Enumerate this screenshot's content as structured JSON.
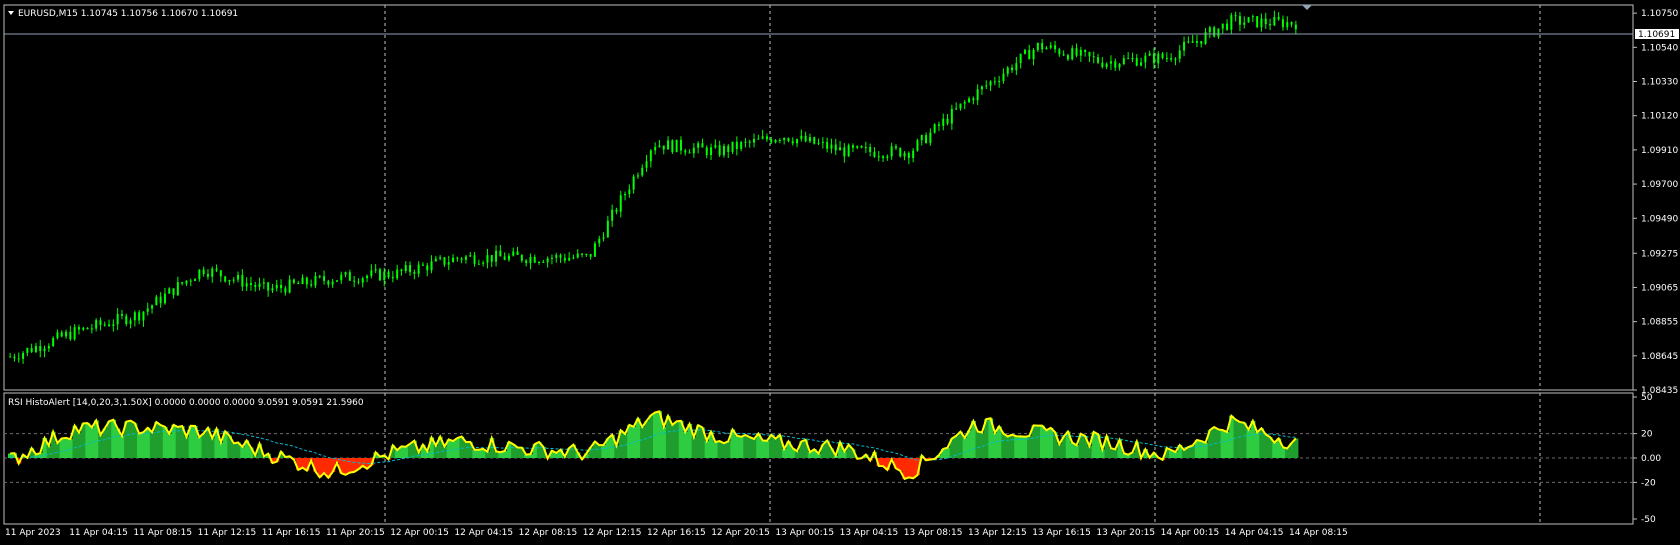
{
  "main_panel": {
    "title": "EURUSD,M15  1.10745 1.10756 1.10670 1.10691",
    "current_price": "1.10691",
    "price_ticks": [
      "1.10750",
      "1.10540",
      "1.10330",
      "1.10120",
      "1.09910",
      "1.09700",
      "1.09490",
      "1.09275",
      "1.09065",
      "1.08855",
      "1.08645",
      "1.08435"
    ]
  },
  "indicator_panel": {
    "title": "RSI HistoAlert [14,0,20,3,1.50X] 0.0000 0.0000 0.0000 9.0591 9.0591 21.5960",
    "ticks": [
      "50",
      "20",
      "0.00",
      "-20",
      "-50"
    ]
  },
  "time_axis": {
    "labels": [
      "11 Apr 2023",
      "11 Apr 04:15",
      "11 Apr 08:15",
      "11 Apr 12:15",
      "11 Apr 16:15",
      "11 Apr 20:15",
      "12 Apr 00:15",
      "12 Apr 04:15",
      "12 Apr 08:15",
      "12 Apr 12:15",
      "12 Apr 16:15",
      "12 Apr 20:15",
      "13 Apr 00:15",
      "13 Apr 04:15",
      "13 Apr 08:15",
      "13 Apr 12:15",
      "13 Apr 16:15",
      "13 Apr 20:15",
      "14 Apr 00:15",
      "14 Apr 04:15",
      "14 Apr 08:15"
    ]
  },
  "colors": {
    "background": "#000000",
    "candle": "#00ff00",
    "price_line": "#8fa3b8",
    "grid": "#c0c0c0",
    "histo_up": "#2ecc40",
    "histo_down": "#ff2a00",
    "rsi_line": "#ffff00",
    "signal_line": "#00bcd4"
  },
  "chart_data": {
    "type": "line",
    "series": [
      {
        "x": [
          "11 Apr 2023",
          "11 Apr 04:15",
          "11 Apr 08:15",
          "11 Apr 12:15",
          "11 Apr 16:15",
          "11 Apr 20:15",
          "12 Apr 00:15",
          "12 Apr 04:15",
          "12 Apr 08:15",
          "12 Apr 12:15",
          "12 Apr 16:15",
          "12 Apr 20:15",
          "13 Apr 00:15",
          "13 Apr 04:15",
          "13 Apr 08:15",
          "13 Apr 12:15",
          "13 Apr 16:15",
          "13 Apr 20:15",
          "14 Apr 00:15",
          "14 Apr 04:15",
          "14 Apr 08:15"
        ],
        "values": [
          1.0864,
          1.0879,
          1.089,
          1.0918,
          1.0905,
          1.0912,
          1.0915,
          1.0925,
          1.0925,
          1.0925,
          1.0995,
          1.099,
          1.1,
          1.099,
          1.099,
          1.1025,
          1.1055,
          1.1045,
          1.1048,
          1.107,
          1.1069
        ]
      }
    ],
    "ylim": [
      1.08435,
      1.108
    ],
    "rsi_histogram": {
      "ylim": [
        -50,
        50
      ],
      "levels": [
        20,
        0,
        -20
      ],
      "x": [
        "11 Apr 2023",
        "11 Apr 04:15",
        "11 Apr 08:15",
        "11 Apr 12:15",
        "11 Apr 16:15",
        "11 Apr 20:15",
        "12 Apr 00:15",
        "12 Apr 04:15",
        "12 Apr 08:15",
        "12 Apr 12:15",
        "12 Apr 16:15",
        "12 Apr 20:15",
        "13 Apr 00:15",
        "13 Apr 04:15",
        "13 Apr 08:15",
        "13 Apr 12:15",
        "13 Apr 16:15",
        "13 Apr 20:15",
        "14 Apr 00:15",
        "14 Apr 04:15",
        "14 Apr 08:15"
      ],
      "values": [
        -2,
        24,
        25,
        22,
        4,
        -12,
        5,
        14,
        8,
        4,
        34,
        18,
        12,
        8,
        -12,
        28,
        20,
        14,
        2,
        30,
        12
      ]
    }
  }
}
